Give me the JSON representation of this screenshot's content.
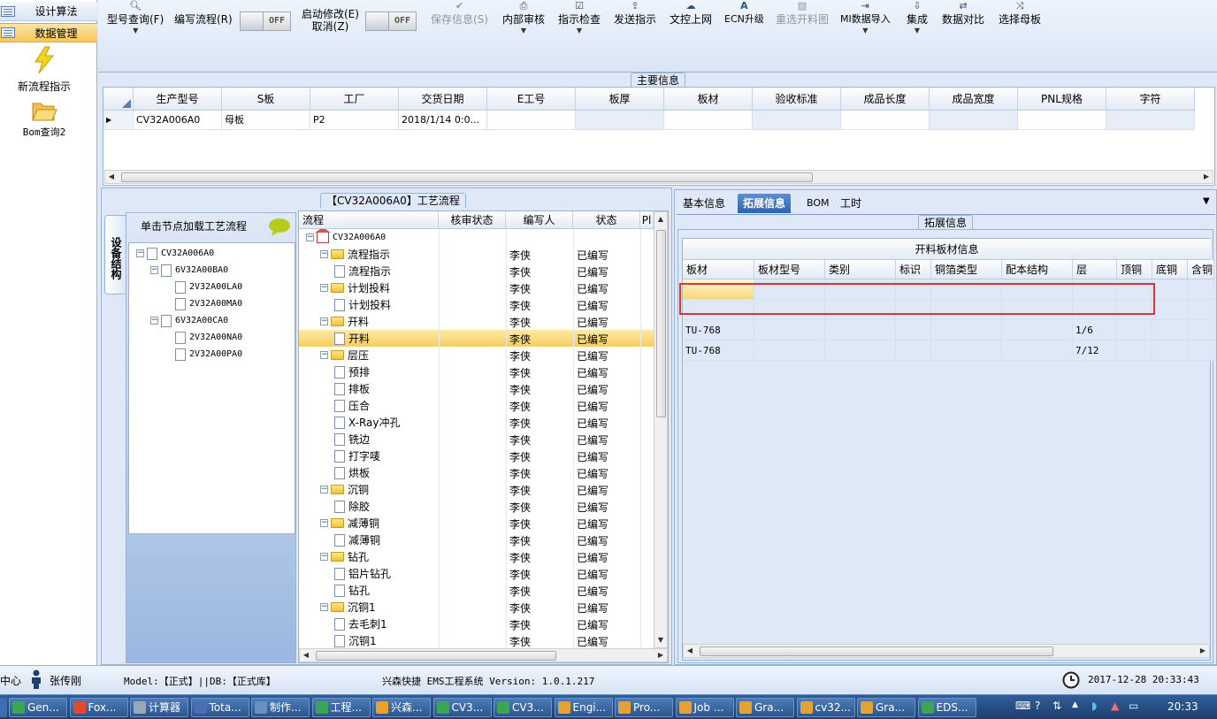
{
  "leftnav": {
    "items": [
      {
        "label": "设计算法",
        "selected": false
      },
      {
        "label": "数据管理",
        "selected": true
      }
    ],
    "big_items": [
      {
        "label": "新流程指示",
        "icon": "lightning-icon"
      },
      {
        "label": "Bom查询2",
        "icon": "folder-open-icon"
      }
    ]
  },
  "toolbar": {
    "model_query": "型号查询(F)",
    "write_flow": "编写流程(R)",
    "write_flow_toggle": "OFF",
    "start_modify_1": "启动修改(E)",
    "start_modify_2": "取消(Z)",
    "start_modify_toggle": "OFF",
    "save_info": "保存信息(S)",
    "internal_review": "内部审核",
    "instruction_check": "指示检查",
    "send_instruction": "发送指示",
    "doc_upload": "文控上网",
    "ecn_upgrade": "ECN升级",
    "reselect_chart": "重选开料图",
    "mi_import": "MI数据导入",
    "integrate": "集成",
    "data_compare": "数据对比",
    "select_mother": "选择母板"
  },
  "main_info": {
    "title": "主要信息",
    "columns": [
      "生产型号",
      "S板",
      "工厂",
      "交货日期",
      "E工号",
      "板厚",
      "板材",
      "验收标准",
      "成品长度",
      "成品宽度",
      "PNL规格",
      "字符"
    ],
    "rows": [
      [
        "CV32A006A0",
        "母板",
        "P2",
        "2018/1/14 0:0...",
        "",
        "",
        "",
        "",
        "",
        "",
        "",
        ""
      ]
    ]
  },
  "flow_panel": {
    "title": "【CV32A006A0】工艺流程",
    "side_tab": "设备结构",
    "load_hint": "单击节点加载工艺流程",
    "structure_tree": [
      {
        "label": "CV32A006A0",
        "level": 0,
        "expander": "−"
      },
      {
        "label": "6V32A00BA0",
        "level": 1,
        "expander": "−"
      },
      {
        "label": "2V32A00LA0",
        "level": 2
      },
      {
        "label": "2V32A00MA0",
        "level": 2
      },
      {
        "label": "6V32A00CA0",
        "level": 1,
        "expander": "−"
      },
      {
        "label": "2V32A00NA0",
        "level": 2
      },
      {
        "label": "2V32A00PA0",
        "level": 2
      }
    ],
    "columns": [
      "流程",
      "核审状态",
      "编写人",
      "状态",
      "Pl"
    ],
    "rows": [
      {
        "label": "CV32A006A0",
        "level": 0,
        "type": "root",
        "author": "",
        "status": ""
      },
      {
        "label": "流程指示",
        "level": 1,
        "type": "folder",
        "author": "李侠",
        "status": "已编写"
      },
      {
        "label": "流程指示",
        "level": 2,
        "type": "doc",
        "author": "李侠",
        "status": "已编写"
      },
      {
        "label": "计划投料",
        "level": 1,
        "type": "folder",
        "author": "李侠",
        "status": "已编写"
      },
      {
        "label": "计划投料",
        "level": 2,
        "type": "doc",
        "author": "李侠",
        "status": "已编写"
      },
      {
        "label": "开料",
        "level": 1,
        "type": "folder",
        "author": "李侠",
        "status": "已编写"
      },
      {
        "label": "开料",
        "level": 2,
        "type": "doc",
        "author": "李侠",
        "status": "已编写",
        "selected": true
      },
      {
        "label": "层压",
        "level": 1,
        "type": "folder",
        "author": "李侠",
        "status": "已编写"
      },
      {
        "label": "预排",
        "level": 2,
        "type": "doc",
        "author": "李侠",
        "status": "已编写"
      },
      {
        "label": "排板",
        "level": 2,
        "type": "doc",
        "author": "李侠",
        "status": "已编写"
      },
      {
        "label": "压合",
        "level": 2,
        "type": "doc",
        "author": "李侠",
        "status": "已编写"
      },
      {
        "label": "X-Ray冲孔",
        "level": 2,
        "type": "doc",
        "author": "李侠",
        "status": "已编写"
      },
      {
        "label": "铣边",
        "level": 2,
        "type": "doc",
        "author": "李侠",
        "status": "已编写"
      },
      {
        "label": "打字唛",
        "level": 2,
        "type": "doc",
        "author": "李侠",
        "status": "已编写"
      },
      {
        "label": "烘板",
        "level": 2,
        "type": "doc",
        "author": "李侠",
        "status": "已编写"
      },
      {
        "label": "沉铜",
        "level": 1,
        "type": "folder",
        "author": "李侠",
        "status": "已编写"
      },
      {
        "label": "除胶",
        "level": 2,
        "type": "doc",
        "author": "李侠",
        "status": "已编写"
      },
      {
        "label": "减薄铜",
        "level": 1,
        "type": "folder",
        "author": "李侠",
        "status": "已编写"
      },
      {
        "label": "减薄铜",
        "level": 2,
        "type": "doc",
        "author": "李侠",
        "status": "已编写"
      },
      {
        "label": "钻孔",
        "level": 1,
        "type": "folder",
        "author": "李侠",
        "status": "已编写"
      },
      {
        "label": "铝片钻孔",
        "level": 2,
        "type": "doc",
        "author": "李侠",
        "status": "已编写"
      },
      {
        "label": "钻孔",
        "level": 2,
        "type": "doc",
        "author": "李侠",
        "status": "已编写"
      },
      {
        "label": "沉铜1",
        "level": 1,
        "type": "folder",
        "author": "李侠",
        "status": "已编写"
      },
      {
        "label": "去毛刺1",
        "level": 2,
        "type": "doc",
        "author": "李侠",
        "status": "已编写"
      },
      {
        "label": "沉铜1",
        "level": 2,
        "type": "doc",
        "author": "李侠",
        "status": "已编写"
      }
    ]
  },
  "detail_panel": {
    "tabs": [
      {
        "label": "基本信息",
        "active": false
      },
      {
        "label": "拓展信息",
        "active": true
      },
      {
        "label": "BOM",
        "active": false
      },
      {
        "label": "工时",
        "active": false
      }
    ],
    "group_title": "拓展信息",
    "table_title": "开料板材信息",
    "columns": [
      "板材",
      "板材型号",
      "类别",
      "标识",
      "铜箔类型",
      "配本结构",
      "层",
      "顶铜",
      "底铜",
      "含铜"
    ],
    "rows": [
      [
        "",
        "",
        "",
        "",
        "",
        "",
        "",
        "",
        "",
        ""
      ],
      [
        "",
        "",
        "",
        "",
        "",
        "",
        "",
        "",
        "",
        ""
      ],
      [
        "TU-768",
        "",
        "",
        "",
        "",
        "",
        "1/6",
        "",
        "",
        ""
      ],
      [
        "TU-768",
        "",
        "",
        "",
        "",
        "",
        "7/12",
        "",
        "",
        ""
      ]
    ]
  },
  "status_bar": {
    "left_label": "中心",
    "user": "张传刚",
    "model": "Model:【正式】||DB:【正式库】",
    "system": "兴森快捷 EMS工程系统 Version: 1.0.1.217",
    "datetime": "2017-12-28 20:33:43"
  },
  "taskbar": {
    "items": [
      {
        "label": "Gen...",
        "color": "#3aa655"
      },
      {
        "label": "Fox...",
        "color": "#e2482f"
      },
      {
        "label": "计算器",
        "color": "#9aa7b8"
      },
      {
        "label": "Tota...",
        "color": "#4a6fb5"
      },
      {
        "label": "制作...",
        "color": "#6c8fc2"
      },
      {
        "label": "工程...",
        "color": "#3aa655"
      },
      {
        "label": "兴森...",
        "color": "#e8a230"
      },
      {
        "label": "CV3...",
        "color": "#3aa655"
      },
      {
        "label": "CV3...",
        "color": "#3aa655"
      },
      {
        "label": "Engi...",
        "color": "#e2a23a"
      },
      {
        "label": "Pro...",
        "color": "#e2a23a"
      },
      {
        "label": "Job ...",
        "color": "#e2a23a"
      },
      {
        "label": "Gra...",
        "color": "#e2a23a"
      },
      {
        "label": "cv32...",
        "color": "#e2a23a"
      },
      {
        "label": "Gra...",
        "color": "#e2a23a"
      },
      {
        "label": "EDS...",
        "color": "#3aa655"
      }
    ],
    "clock": "20:33"
  }
}
